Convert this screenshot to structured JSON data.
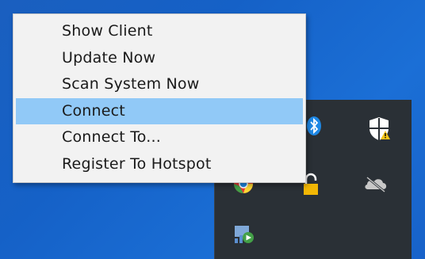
{
  "context_menu": {
    "items": [
      {
        "label": "Show Client",
        "highlighted": false
      },
      {
        "label": "Update Now",
        "highlighted": false
      },
      {
        "label": "Scan System Now",
        "highlighted": false
      },
      {
        "label": "Connect",
        "highlighted": true
      },
      {
        "label": "Connect To...",
        "highlighted": false
      },
      {
        "label": "Register To Hotspot",
        "highlighted": false
      }
    ]
  },
  "tray_icons": [
    {
      "name": "bluetooth-icon"
    },
    {
      "name": "windows-security-warning-icon"
    },
    {
      "name": "chrome-icon"
    },
    {
      "name": "lock-icon"
    },
    {
      "name": "onedrive-offline-icon"
    },
    {
      "name": "app-tray-icon"
    }
  ],
  "colors": {
    "desktop": "#1561c7",
    "tray_background": "#2a3036",
    "menu_background": "#f2f2f2",
    "menu_highlight": "#91c9f7"
  }
}
